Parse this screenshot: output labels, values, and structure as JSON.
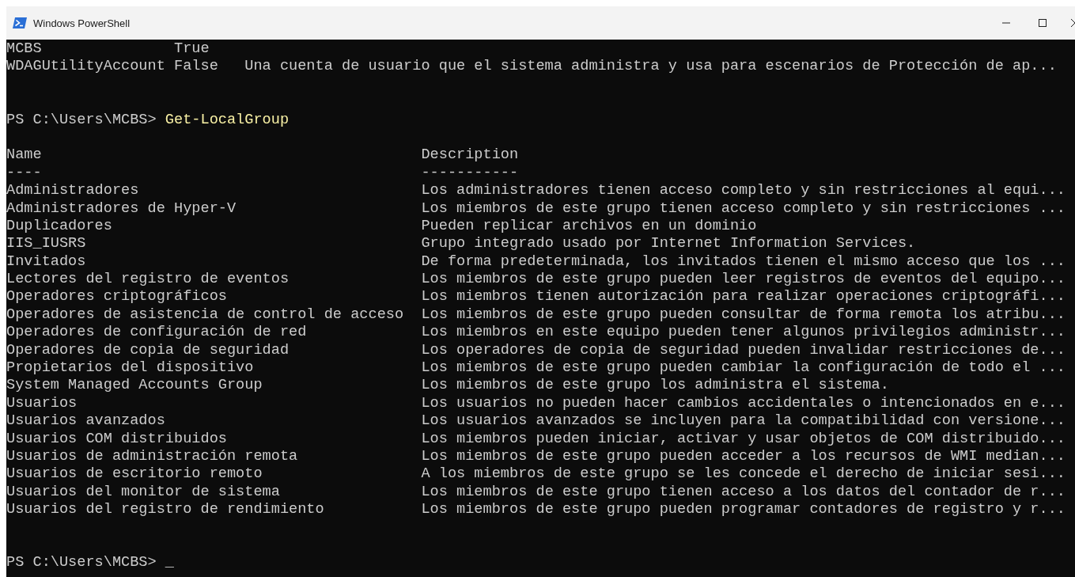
{
  "window": {
    "title": "Windows PowerShell"
  },
  "previous_output": {
    "rows": [
      {
        "name": "MCBS",
        "enabled": "True"
      },
      {
        "name": "WDAGUtilityAccount",
        "enabled": "False",
        "description": "Una cuenta de usuario que el sistema administra y usa para escenarios de Protección de ap..."
      }
    ]
  },
  "command": {
    "prompt": "PS C:\\Users\\MCBS>",
    "text": "Get-LocalGroup"
  },
  "table": {
    "columns": [
      {
        "heading": "Name",
        "underline": "----"
      },
      {
        "heading": "Description",
        "underline": "-----------"
      }
    ],
    "rows": [
      {
        "name": "Administradores",
        "description": "Los administradores tienen acceso completo y sin restricciones al equi..."
      },
      {
        "name": "Administradores de Hyper-V",
        "description": "Los miembros de este grupo tienen acceso completo y sin restricciones ..."
      },
      {
        "name": "Duplicadores",
        "description": "Pueden replicar archivos en un dominio"
      },
      {
        "name": "IIS_IUSRS",
        "description": "Grupo integrado usado por Internet Information Services."
      },
      {
        "name": "Invitados",
        "description": "De forma predeterminada, los invitados tienen el mismo acceso que los ..."
      },
      {
        "name": "Lectores del registro de eventos",
        "description": "Los miembros de este grupo pueden leer registros de eventos del equipo..."
      },
      {
        "name": "Operadores criptográficos",
        "description": "Los miembros tienen autorización para realizar operaciones criptográfi..."
      },
      {
        "name": "Operadores de asistencia de control de acceso",
        "description": "Los miembros de este grupo pueden consultar de forma remota los atribu..."
      },
      {
        "name": "Operadores de configuración de red",
        "description": "Los miembros en este equipo pueden tener algunos privilegios administr..."
      },
      {
        "name": "Operadores de copia de seguridad",
        "description": "Los operadores de copia de seguridad pueden invalidar restricciones de..."
      },
      {
        "name": "Propietarios del dispositivo",
        "description": "Los miembros de este grupo pueden cambiar la configuración de todo el ..."
      },
      {
        "name": "System Managed Accounts Group",
        "description": "Los miembros de este grupo los administra el sistema."
      },
      {
        "name": "Usuarios",
        "description": "Los usuarios no pueden hacer cambios accidentales o intencionados en e..."
      },
      {
        "name": "Usuarios avanzados",
        "description": "Los usuarios avanzados se incluyen para la compatibilidad con versione..."
      },
      {
        "name": "Usuarios COM distribuidos",
        "description": "Los miembros pueden iniciar, activar y usar objetos de COM distribuido..."
      },
      {
        "name": "Usuarios de administración remota",
        "description": "Los miembros de este grupo pueden acceder a los recursos de WMI median..."
      },
      {
        "name": "Usuarios de escritorio remoto",
        "description": "A los miembros de este grupo se les concede el derecho de iniciar sesi..."
      },
      {
        "name": "Usuarios del monitor de sistema",
        "description": "Los miembros de este grupo tienen acceso a los datos del contador de r..."
      },
      {
        "name": "Usuarios del registro de rendimiento",
        "description": "Los miembros de este grupo pueden programar contadores de registro y r..."
      }
    ]
  },
  "final_prompt": {
    "prompt": "PS C:\\Users\\MCBS>",
    "cursor": "_"
  }
}
